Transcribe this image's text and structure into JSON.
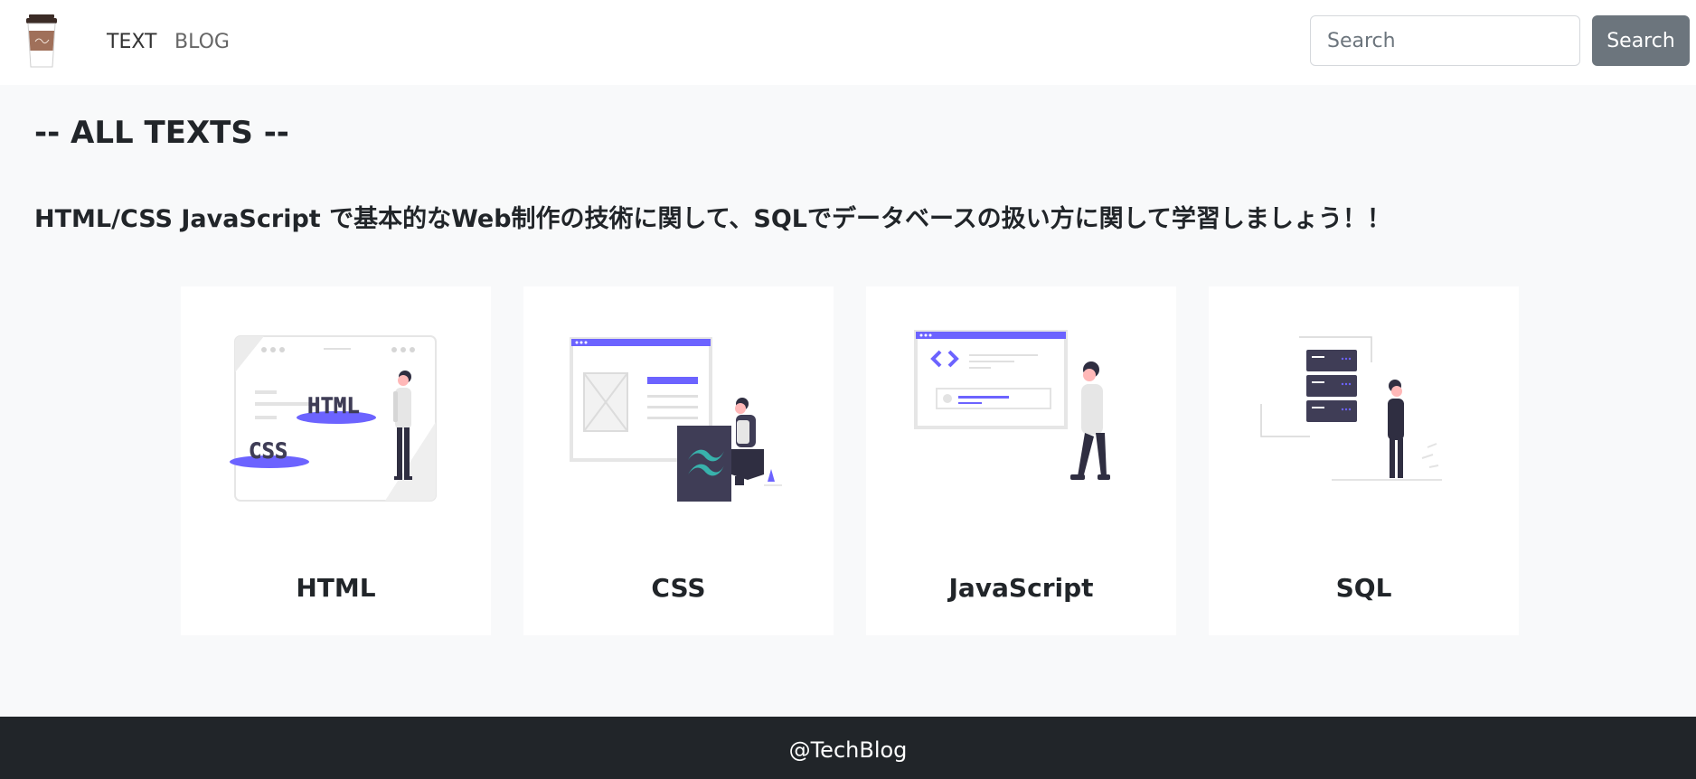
{
  "nav": {
    "logo": "coffee-cup-logo",
    "links": [
      "TEXT",
      "BLOG"
    ],
    "search_placeholder": "Search",
    "search_button": "Search"
  },
  "main": {
    "heading": "-- ALL TEXTS --",
    "intro": "HTML/CSS JavaScript で基本的なWeb制作の技術に関して、SQLでデータベースの扱い方に関して学習しましょう！！",
    "cards": [
      {
        "title": "HTML",
        "badges": [
          "HTML",
          "CSS"
        ]
      },
      {
        "title": "CSS"
      },
      {
        "title": "JavaScript"
      },
      {
        "title": "SQL"
      }
    ]
  },
  "footer": {
    "text": "@TechBlog"
  },
  "colors": {
    "accent": "#6c63ff",
    "teal": "#38b2ac",
    "dark": "#3f3d56",
    "footer_bg": "#212529",
    "page_bg": "#f8f9fa",
    "button_bg": "#6c757d"
  }
}
